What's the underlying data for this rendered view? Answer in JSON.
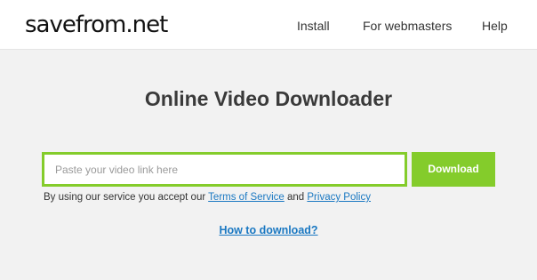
{
  "header": {
    "logo": "savefrom.net",
    "nav": {
      "install": "Install",
      "webmasters": "For webmasters",
      "help": "Help"
    }
  },
  "main": {
    "title": "Online Video Downloader",
    "input": {
      "value": "",
      "placeholder": "Paste your video link here"
    },
    "download_label": "Download",
    "terms": {
      "prefix": "By using our service you accept our ",
      "tos_link": "Terms of Service",
      "and": " and ",
      "privacy_link": "Privacy Policy"
    },
    "howto_link": "How to download?"
  },
  "colors": {
    "accent": "#84cc2b",
    "link": "#1a78c2",
    "background": "#f2f2f2"
  }
}
